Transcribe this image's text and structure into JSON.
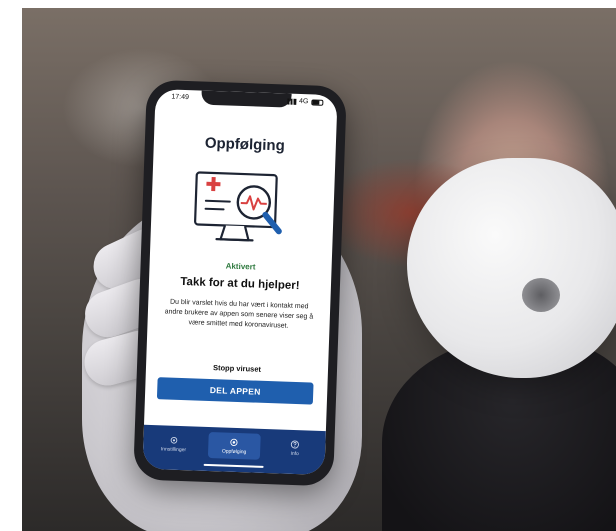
{
  "status_bar": {
    "time": "17:49",
    "network": "4G"
  },
  "app": {
    "title": "Oppfølging",
    "status_label": "Aktivert",
    "heading": "Takk for at du hjelper!",
    "body": "Du blir varslet hvis du har vært i kontakt med andre brukere av appen som senere viser seg å være smittet med koronaviruset.",
    "stop_link": "Stopp viruset",
    "share_button": "DEL APPEN"
  },
  "tabs": [
    {
      "label": "Innstillinger",
      "icon": "gear-icon",
      "active": false
    },
    {
      "label": "Oppfølging",
      "icon": "target-icon",
      "active": true
    },
    {
      "label": "Info",
      "icon": "question-icon",
      "active": false
    }
  ],
  "colors": {
    "accent": "#1f5fae",
    "tab_bar": "#183a7a",
    "status_green": "#2f7a3f",
    "illustration_red": "#d94141"
  }
}
